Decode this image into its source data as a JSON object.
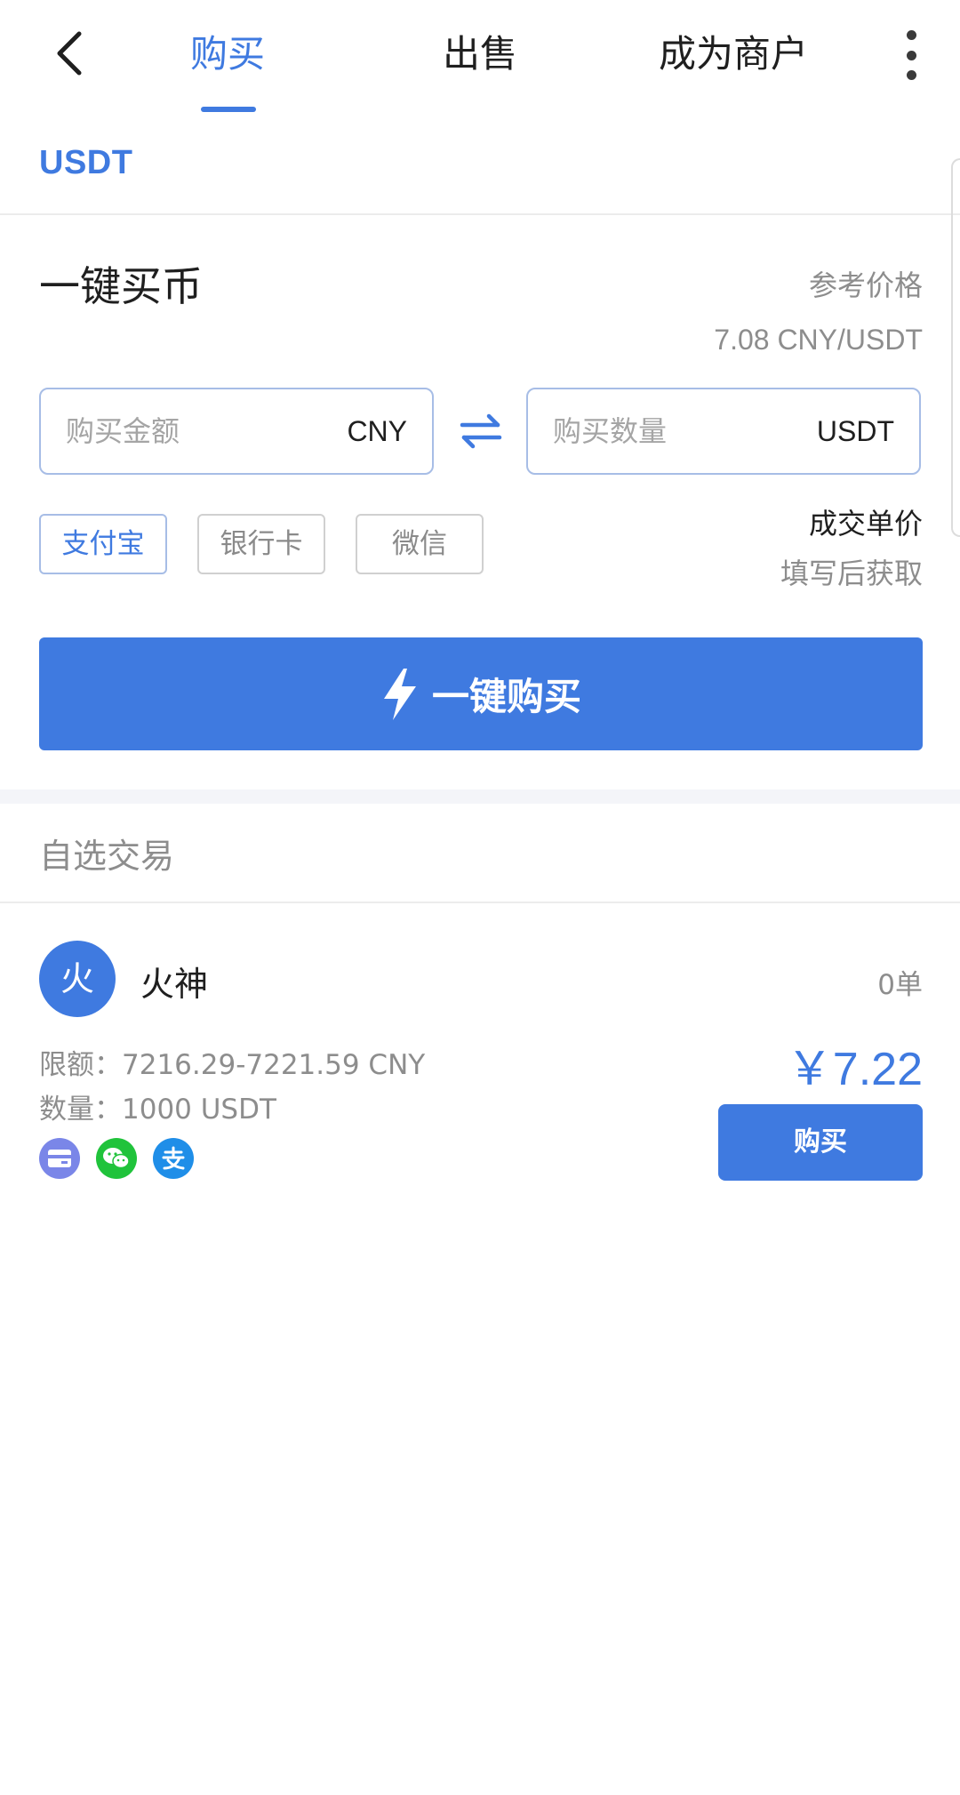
{
  "nav": {
    "tabs": [
      {
        "label": "购买",
        "active": true
      },
      {
        "label": "出售",
        "active": false
      },
      {
        "label": "成为商户",
        "active": false
      }
    ]
  },
  "coin": {
    "symbol": "USDT"
  },
  "quick_buy": {
    "title": "一键买币",
    "ref_price_label": "参考价格",
    "ref_price_value": "7.08 CNY/USDT",
    "amount_input": {
      "placeholder": "购买金额",
      "value": "",
      "unit": "CNY"
    },
    "quantity_input": {
      "placeholder": "购买数量",
      "value": "",
      "unit": "USDT"
    },
    "payment_methods": [
      {
        "label": "支付宝",
        "selected": true
      },
      {
        "label": "银行卡",
        "selected": false
      },
      {
        "label": "微信",
        "selected": false
      }
    ],
    "unit_price_label": "成交单价",
    "unit_price_value": "填写后获取",
    "buy_button": "一键购买"
  },
  "favorites": {
    "title": "自选交易",
    "merchants": [
      {
        "avatar_text": "火",
        "name": "火神",
        "orders": "0单",
        "limit": "限额：7216.29-7221.59 CNY",
        "quantity": "数量：1000 USDT",
        "price": "￥7.22",
        "buy_label": "购买",
        "payment_icons": [
          "bank-card-icon",
          "wechat-icon",
          "alipay-icon"
        ]
      }
    ]
  },
  "colors": {
    "accent": "#3f7ae0",
    "wechat": "#20c33b",
    "alipay": "#1f8ee8",
    "card": "#7a86e8"
  }
}
